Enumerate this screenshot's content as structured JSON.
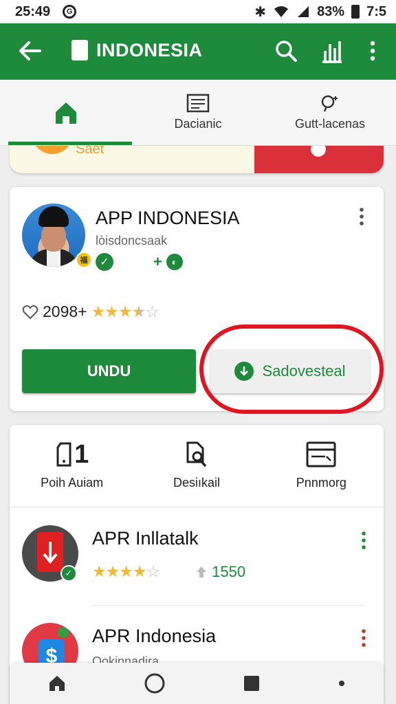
{
  "status_bar": {
    "time": "25:49",
    "battery": "83%",
    "clock_right": "7:5"
  },
  "app_bar": {
    "title": "INDONESIA"
  },
  "tabs": [
    {
      "label": "",
      "icon": "home-icon",
      "active": true
    },
    {
      "label": "Dacianic",
      "icon": "document-icon",
      "active": false
    },
    {
      "label": "Gutt-lacenas",
      "icon": "search-plus-icon",
      "active": false
    }
  ],
  "banner": {
    "text": "Saet"
  },
  "app_card": {
    "name": "APP INDONESIA",
    "subtitle": "lòisdoncsaak",
    "avatar_badge": "福",
    "likes": "2098+",
    "rating": 3.5,
    "primary_button": "UNDU",
    "secondary_button": "Sadovesteal"
  },
  "categories": [
    {
      "label": "Poih Auiam",
      "glyph": "1"
    },
    {
      "label": "Desiıkail"
    },
    {
      "label": "Pnnmorg"
    }
  ],
  "list_items": [
    {
      "title": "APR Inllatalk",
      "rating": 3.5,
      "count": "1550"
    },
    {
      "title": "APR Indonesia",
      "subtitle": "Ookinnadira"
    }
  ],
  "colors": {
    "brand_green": "#1e8a3c",
    "highlight_red": "#e0151f",
    "star_yellow": "#f5b82e"
  }
}
